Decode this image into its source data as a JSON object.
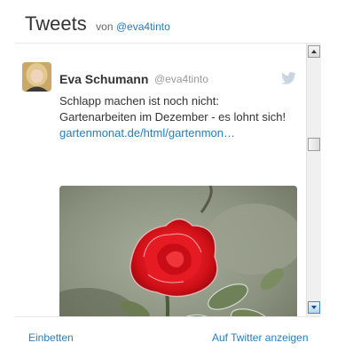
{
  "header": {
    "title": "Tweets",
    "by_prefix": "von",
    "by_handle": "@eva4tinto"
  },
  "tweet": {
    "author_name": "Eva Schumann",
    "author_handle": "@eva4tinto",
    "text": "Schlapp machen ist noch nicht: Gartenarbeiten im Dezember - es lohnt sich!",
    "link_text": "gartenmonat.de/html/gartenmon…",
    "media_alt": "frosted-red-rose-photo",
    "brand_icon": "twitter-bird-icon"
  },
  "footer": {
    "embed_label": "Einbetten",
    "view_label": "Auf Twitter anzeigen"
  },
  "colors": {
    "link": "#2b7bb9",
    "text": "#333333",
    "muted": "#999999",
    "bird": "#c9d6e2"
  }
}
